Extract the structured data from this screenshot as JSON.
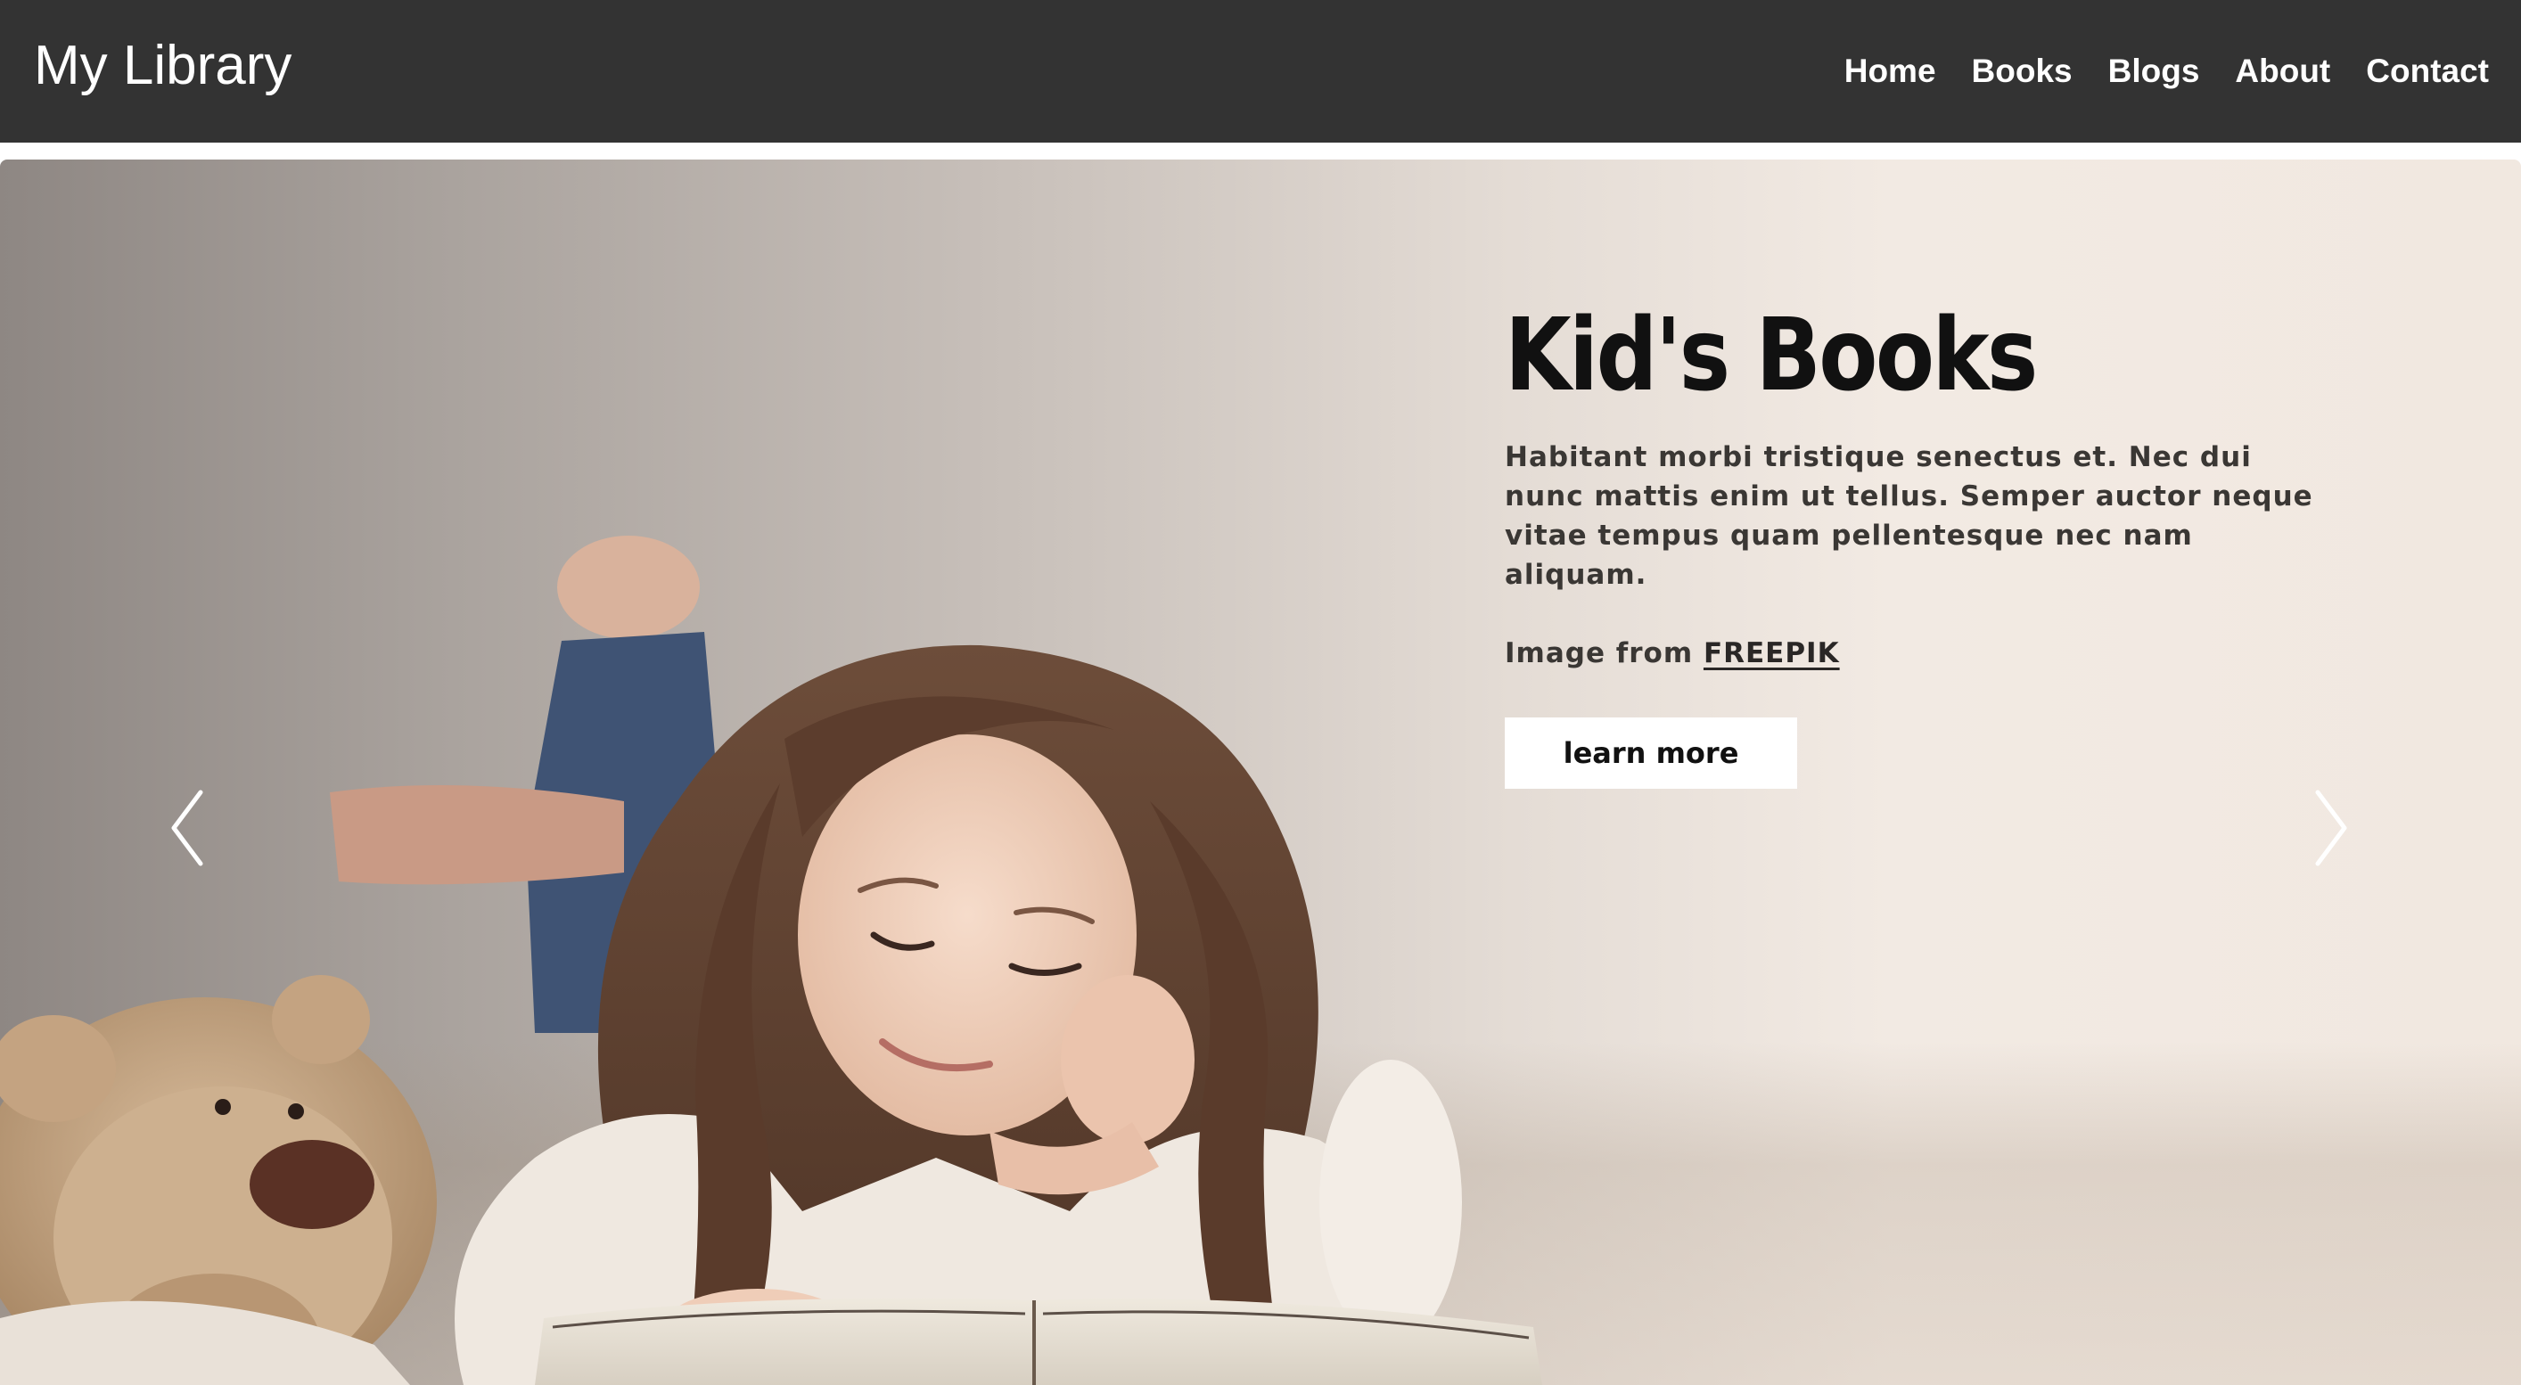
{
  "navbar": {
    "brand": "My Library",
    "links": [
      "Home",
      "Books",
      "Blogs",
      "About",
      "Contact"
    ],
    "background": "#333333"
  },
  "hero": {
    "title": "Kid's Books",
    "description": "Habitant morbi tristique senectus et. Nec dui nunc mattis enim ut tellus. Semper auctor neque vitae tempus quam pellentesque nec nam aliquam.",
    "credit_prefix": "Image from",
    "credit_link": "FREEPIK",
    "button_label": "learn more",
    "prev_icon": "chevron-left-icon",
    "next_icon": "chevron-right-icon"
  }
}
